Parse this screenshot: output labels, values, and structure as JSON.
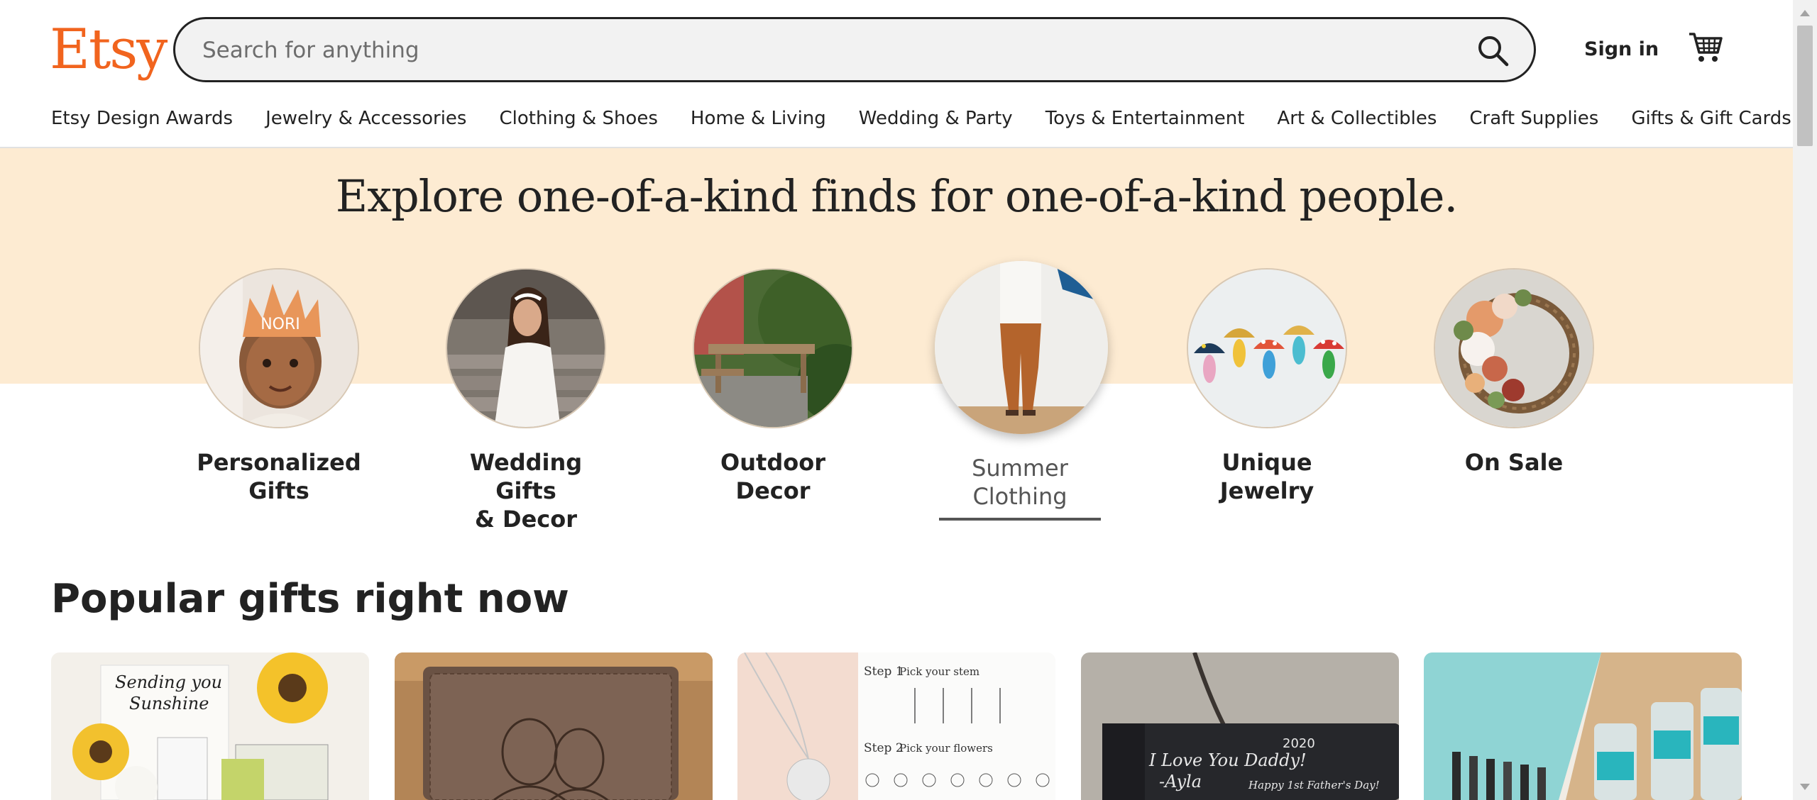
{
  "header": {
    "logo": "Etsy",
    "search_placeholder": "Search for anything",
    "signin_label": "Sign in",
    "search_icon": "search-icon",
    "cart_icon": "cart-icon"
  },
  "nav": {
    "items": [
      "Etsy Design Awards",
      "Jewelry & Accessories",
      "Clothing & Shoes",
      "Home & Living",
      "Wedding & Party",
      "Toys & Entertainment",
      "Art & Collectibles",
      "Craft Supplies",
      "Gifts & Gift Cards"
    ]
  },
  "hero": {
    "title": "Explore one-of-a-kind finds for one-of-a-kind people.",
    "categories": [
      {
        "line1": "Personalized",
        "line2": "Gifts"
      },
      {
        "line1": "Wedding Gifts",
        "line2": "& Decor"
      },
      {
        "line1": "Outdoor",
        "line2": "Decor"
      },
      {
        "line1": "Summer",
        "line2": "Clothing"
      },
      {
        "line1": "Unique",
        "line2": "Jewelry"
      },
      {
        "line1": "On Sale",
        "line2": ""
      }
    ],
    "crown_text": "NORI"
  },
  "popular": {
    "title": "Popular gifts right now",
    "card1_text1": "Sending you",
    "card1_text2": "Sunshine",
    "card3_step1": "Step 1",
    "card3_step1_label": "Pick your stem",
    "card3_step2": "Step 2",
    "card3_step2_label": "Pick your flowers",
    "card4_line1": "I Love You Daddy!",
    "card4_line2": "-Ayla",
    "card4_year": "2020",
    "card4_line3": "Happy 1st Father's Day!"
  },
  "colors": {
    "brand": "#F1641E",
    "hero_band": "#FDEBD2"
  }
}
